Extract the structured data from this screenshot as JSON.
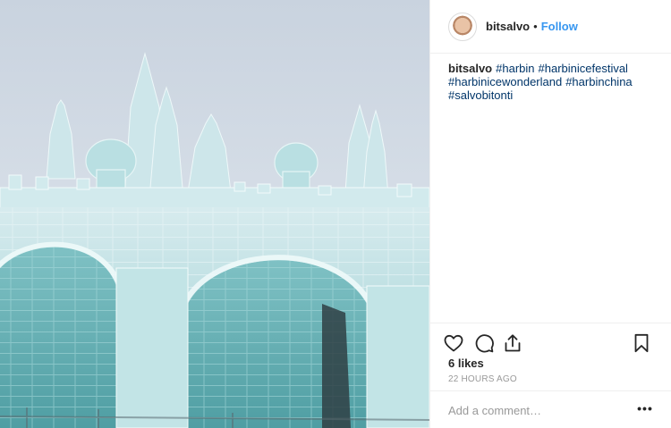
{
  "post": {
    "author": "bitsalvo",
    "separator": "•",
    "follow_label": "Follow",
    "caption_user": "bitsalvo",
    "hashtags": [
      "#harbin",
      "#harbinicefestival",
      "#harbinicewonderland",
      "#harbinchina",
      "#salvobitonti"
    ],
    "likes": "6 likes",
    "timestamp": "22 HOURS AGO",
    "comment_placeholder": "Add a comment…",
    "more_options": "•••"
  },
  "icons": {
    "like": "heart-icon",
    "comment": "comment-icon",
    "share": "share-icon",
    "save": "bookmark-icon"
  },
  "colors": {
    "link_blue": "#3897f0",
    "hashtag": "#003569",
    "muted": "#999999",
    "text": "#262626"
  }
}
